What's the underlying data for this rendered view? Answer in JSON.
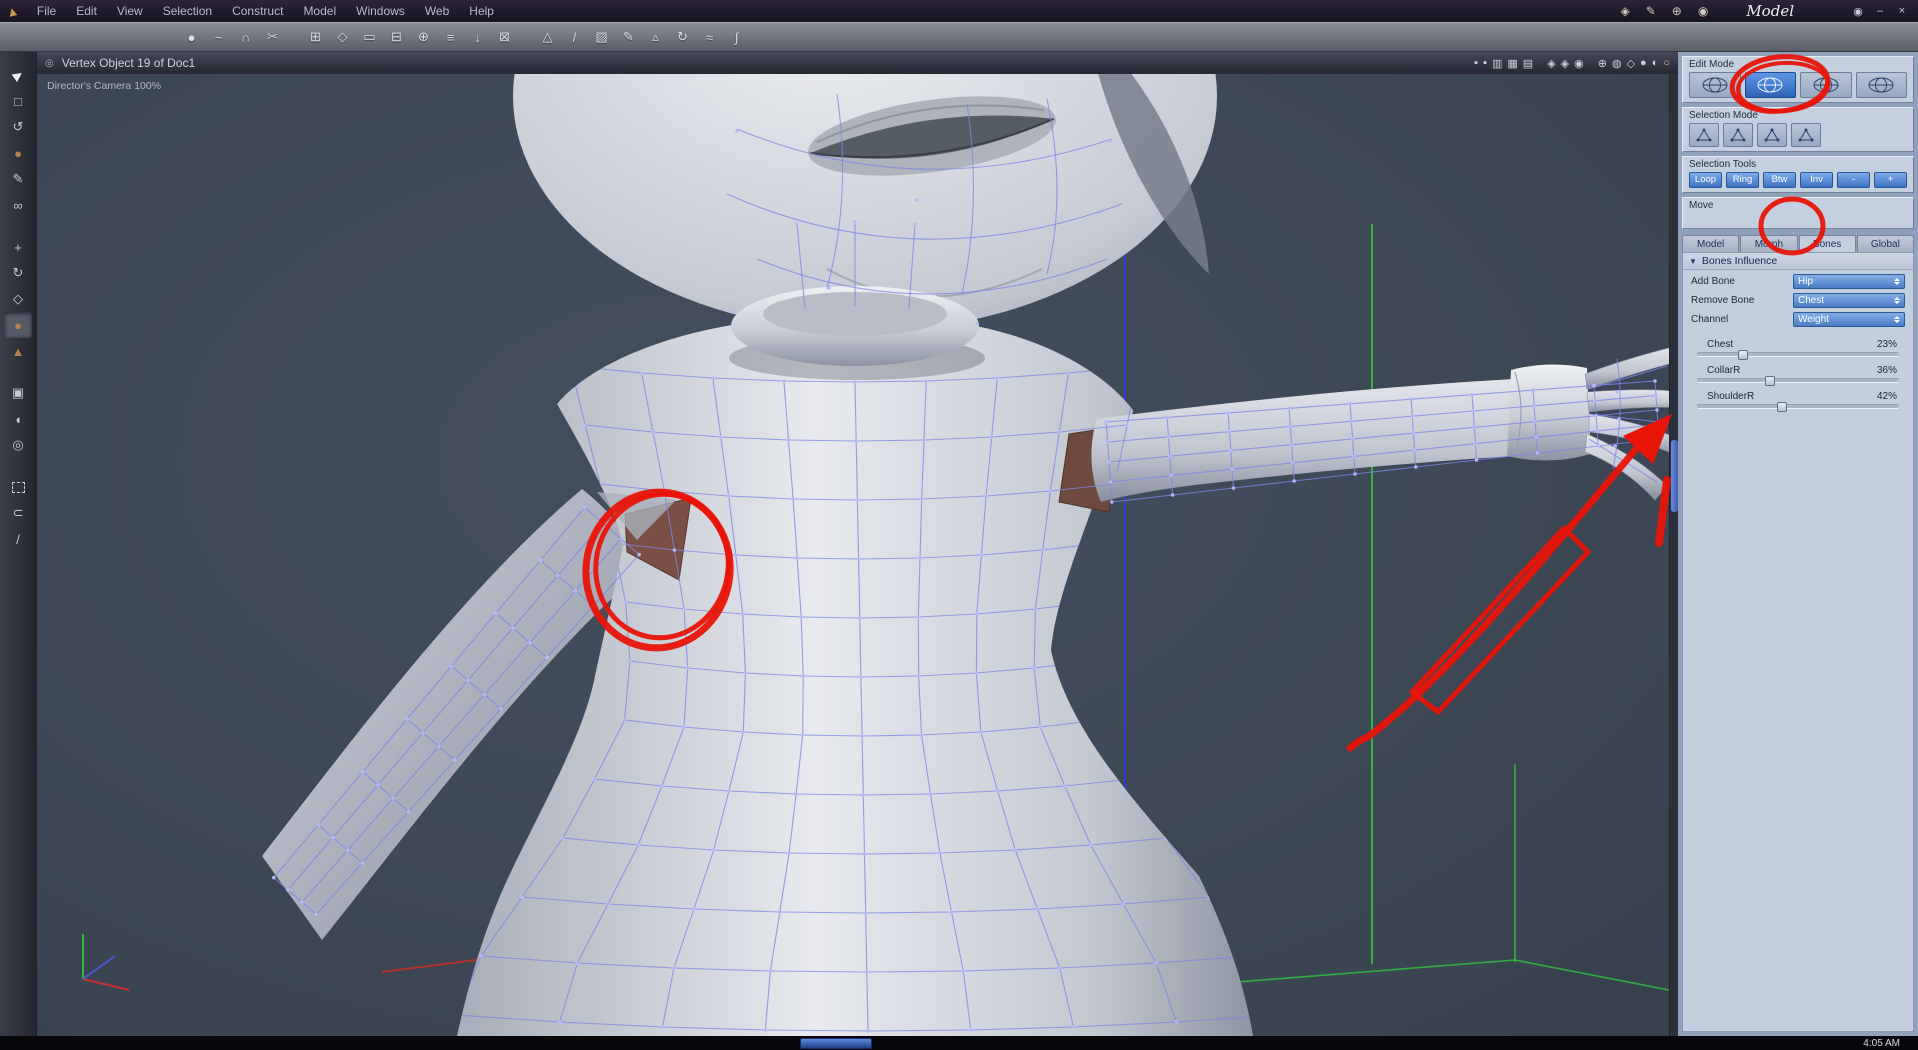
{
  "window": {
    "title": "Model",
    "controls": [
      {
        "name": "eye-button",
        "glyph": "◉"
      },
      {
        "name": "minimize-button",
        "glyph": "–"
      },
      {
        "name": "close-button",
        "glyph": "×"
      }
    ]
  },
  "menubar": {
    "logo_glyph": "▲",
    "items": [
      "File",
      "Edit",
      "View",
      "Selection",
      "Construct",
      "Model",
      "Windows",
      "Web",
      "Help"
    ],
    "right_icons": [
      {
        "name": "pan-hand-icon",
        "glyph": "◈"
      },
      {
        "name": "paint-icon",
        "glyph": "✎"
      },
      {
        "name": "target-icon",
        "glyph": "⊕"
      },
      {
        "name": "pointer-icon",
        "glyph": "◉"
      }
    ]
  },
  "toolbar": {
    "icons": [
      {
        "name": "sphere-primitive-icon",
        "glyph": "●"
      },
      {
        "name": "curve-icon",
        "glyph": "~"
      },
      {
        "name": "arc-icon",
        "glyph": "∩"
      },
      {
        "name": "scissors-icon",
        "glyph": "✂"
      },
      {
        "name": "grid-icon",
        "glyph": "⊞",
        "gap": true
      },
      {
        "name": "diamond-icon",
        "glyph": "◇"
      },
      {
        "name": "plane-icon",
        "glyph": "▭"
      },
      {
        "name": "boolean-subtract-icon",
        "glyph": "⊟"
      },
      {
        "name": "boolean-add-icon",
        "glyph": "⊕"
      },
      {
        "name": "layers-icon",
        "glyph": "≡"
      },
      {
        "name": "drop-icon",
        "glyph": "↓"
      },
      {
        "name": "delete-icon",
        "glyph": "⊠"
      },
      {
        "name": "cone-icon",
        "glyph": "△",
        "gap": true
      },
      {
        "name": "knife-icon",
        "glyph": "/"
      },
      {
        "name": "hatch-icon",
        "glyph": "▨"
      },
      {
        "name": "pen-icon",
        "glyph": "✎"
      },
      {
        "name": "pyramid-icon",
        "glyph": "▵"
      },
      {
        "name": "spin-icon",
        "glyph": "↻"
      },
      {
        "name": "wave-icon",
        "glyph": "≈"
      },
      {
        "name": "bend-icon",
        "glyph": "∫"
      }
    ]
  },
  "left_tools": {
    "tools": [
      {
        "name": "select-tool",
        "glyph": "▶",
        "kind": "cursor"
      },
      {
        "name": "marquee-tool",
        "glyph": "□"
      },
      {
        "name": "rotate-view-tool",
        "glyph": "↺"
      },
      {
        "name": "soft-select-tool",
        "glyph": "●",
        "kind": "brown"
      },
      {
        "name": "pen-tool",
        "glyph": "✎"
      },
      {
        "name": "weld-tool",
        "glyph": "∞"
      },
      {
        "name": "move-tool",
        "glyph": "+",
        "gap": true
      },
      {
        "name": "rotate-tool",
        "glyph": "↻"
      },
      {
        "name": "scale-tool",
        "glyph": "◇"
      },
      {
        "name": "paint-weights-tool",
        "glyph": "●",
        "kind": "brown",
        "active": true
      },
      {
        "name": "cone-tool",
        "glyph": "▲",
        "kind": "brown"
      },
      {
        "name": "camera-tool",
        "glyph": "▣",
        "gap": true
      },
      {
        "name": "pan-tool",
        "glyph": "◖"
      },
      {
        "name": "zoom-tool",
        "glyph": "◎"
      },
      {
        "name": "rect-select-tool",
        "glyph": "",
        "kind": "dashed",
        "gap": true
      },
      {
        "name": "lasso-tool",
        "glyph": "⊂"
      },
      {
        "name": "line-tool",
        "glyph": "/"
      }
    ]
  },
  "viewport": {
    "title": "Vertex Object 19 of Doc1",
    "menu_icon_glyph": "◎",
    "camera_label": "Director's Camera 100%",
    "title_icons": [
      {
        "name": "wireframe-mode-icon",
        "glyph": "▪"
      },
      {
        "name": "shaded-mode-icon",
        "glyph": "▪"
      },
      {
        "name": "split-two-icon",
        "glyph": "▥"
      },
      {
        "name": "split-four-icon",
        "glyph": "▦"
      },
      {
        "name": "split-three-icon",
        "glyph": "▤"
      },
      {
        "name": "shield-a-icon",
        "glyph": "◈",
        "gap": true
      },
      {
        "name": "shield-b-icon",
        "glyph": "◈"
      },
      {
        "name": "shield-c-icon",
        "glyph": "◉"
      },
      {
        "name": "orbit-icon",
        "glyph": "⊕",
        "gap": true
      },
      {
        "name": "wire-globe-icon",
        "glyph": "◍"
      },
      {
        "name": "box-icon",
        "glyph": "◇"
      },
      {
        "name": "sphere-icon",
        "glyph": "●"
      },
      {
        "name": "contrast-icon",
        "glyph": "◐"
      },
      {
        "name": "ring-icon",
        "glyph": "○"
      }
    ]
  },
  "right_panel": {
    "edit_mode": {
      "label": "Edit Mode",
      "buttons": [
        {
          "name": "edit-mode-wire-button"
        },
        {
          "name": "edit-mode-vertex-button",
          "active": true
        },
        {
          "name": "edit-mode-shaded-button"
        },
        {
          "name": "edit-mode-spheres-button"
        }
      ]
    },
    "selection_mode": {
      "label": "Selection Mode",
      "buttons": [
        {
          "name": "select-vertex-button"
        },
        {
          "name": "select-edge-button"
        },
        {
          "name": "select-face-button"
        },
        {
          "name": "select-object-button"
        }
      ]
    },
    "selection_tools": {
      "label": "Selection Tools",
      "buttons": [
        "Loop",
        "Ring",
        "Btw",
        "Inv",
        "-",
        "+"
      ]
    },
    "move_label": "Move",
    "tabs": [
      {
        "label": "Model"
      },
      {
        "label": "Morph"
      },
      {
        "label": "Bones",
        "active": true
      },
      {
        "label": "Global"
      }
    ],
    "bones": {
      "header": "Bones Influence",
      "header_icon": "▼",
      "fields": [
        {
          "label": "Add Bone",
          "value": "Hip"
        },
        {
          "label": "Remove Bone",
          "value": "Chest"
        },
        {
          "label": "Channel",
          "value": "Weight"
        }
      ],
      "sliders": [
        {
          "name": "Chest",
          "percent": "23%",
          "value": 23
        },
        {
          "name": "CollarR",
          "percent": "36%",
          "value": 36
        },
        {
          "name": "ShoulderR",
          "percent": "42%",
          "value": 42
        }
      ]
    }
  },
  "taskbar": {
    "time": "4:05 AM"
  },
  "colors": {
    "annotation_red": "#e81408",
    "accent_blue": "#4a7fd0",
    "viewport_bg": "#3d4755",
    "wireframe_blue": "#7d87e8",
    "model_gray": "#d6d9e0",
    "defect_brown": "#7b5044"
  }
}
